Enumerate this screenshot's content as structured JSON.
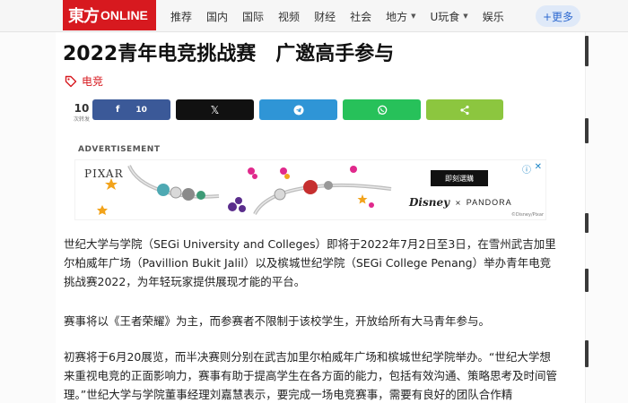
{
  "header": {
    "logo_cn": "東方",
    "logo_en": "ONLINE",
    "nav": [
      "推荐",
      "国内",
      "国际",
      "视频",
      "财经",
      "社会",
      "地方",
      "U玩食",
      "娱乐"
    ],
    "more": "+更多"
  },
  "article": {
    "title": "2022青年电竞挑战赛　广邀高手参与",
    "tag": "电竞",
    "share": {
      "count": "10",
      "count_label": "次转发",
      "facebook_count": "10"
    },
    "paragraphs": [
      "世纪大学与学院（SEGi University and Colleges）即将于2022年7月2日至3日，在雪州武吉加里尔柏威年广场（Pavillion Bukit Jalil）以及槟城世纪学院（SEGi College Penang）举办青年电竞挑战赛2022，为年轻玩家提供展现才能的平台。",
      "赛事将以《王者荣耀》为主，而参赛者不限制于该校学生，开放给所有大马青年参与。",
      "初赛将于6月20展览，而半决赛则分别在武吉加里尔柏威年广场和槟城世纪学院举办。“世纪大学想来重视电竞的正面影响力，赛事有助于提高学生在各方面的能力，包括有效沟通、策略思考及时间管理。”世纪大学与学院董事经理刘嘉慧表示，要完成一场电竞赛事，需要有良好的团队合作精"
    ]
  },
  "ad": {
    "label": "ADVERTISEMENT",
    "brand": "PIXAR",
    "cta": "即刻選購",
    "partner1": "Disney",
    "partner_sep": "×",
    "partner2": "PANDORA",
    "copyright": "©Disney/Pixar"
  },
  "colors": {
    "brand_red": "#d7191f",
    "facebook": "#3b5998",
    "x": "#111111",
    "telegram": "#2f95d6",
    "whatsapp": "#27c15a",
    "share": "#8cc63f"
  }
}
